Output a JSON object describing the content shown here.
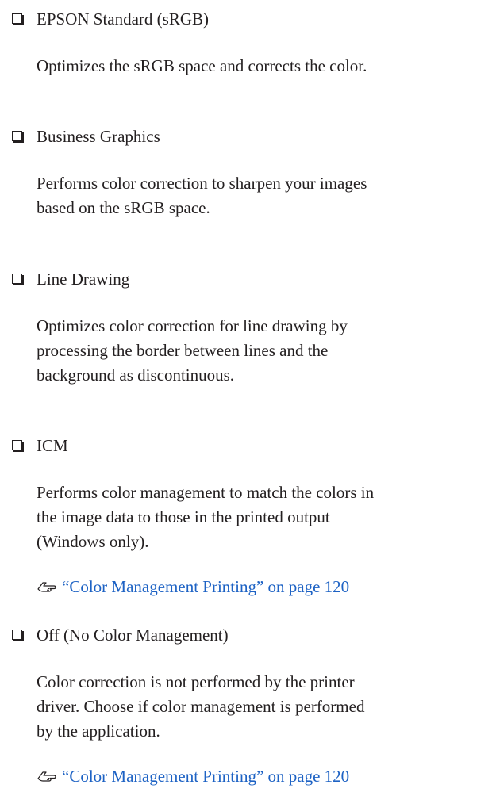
{
  "items": [
    {
      "title": "EPSON Standard (sRGB)",
      "description": [
        "Optimizes the sRGB space and corrects the color."
      ]
    },
    {
      "title": "Business Graphics",
      "description": [
        "Performs color correction to sharpen your images",
        "based on the sRGB space."
      ]
    },
    {
      "title": "Line Drawing",
      "description": [
        "Optimizes color correction for line drawing by",
        "processing the border between lines and the",
        "background as discontinuous."
      ]
    },
    {
      "title": "ICM",
      "description": [
        "Performs color management to match the colors in",
        "the image data to those in the printed output",
        "(Windows only)."
      ],
      "xref": "“Color Management Printing” on page 120"
    },
    {
      "title": "Off (No Color Management)",
      "description": [
        "Color correction is not performed by the printer",
        "driver. Choose if color management is performed",
        "by the application."
      ],
      "xref": "“Color Management Printing” on page 120"
    }
  ],
  "colors": {
    "text": "#231f20",
    "link": "#1d62c4"
  },
  "icons": {
    "xref": "pointing-hand-icon",
    "bullet": "checkbox-bullet-icon"
  }
}
